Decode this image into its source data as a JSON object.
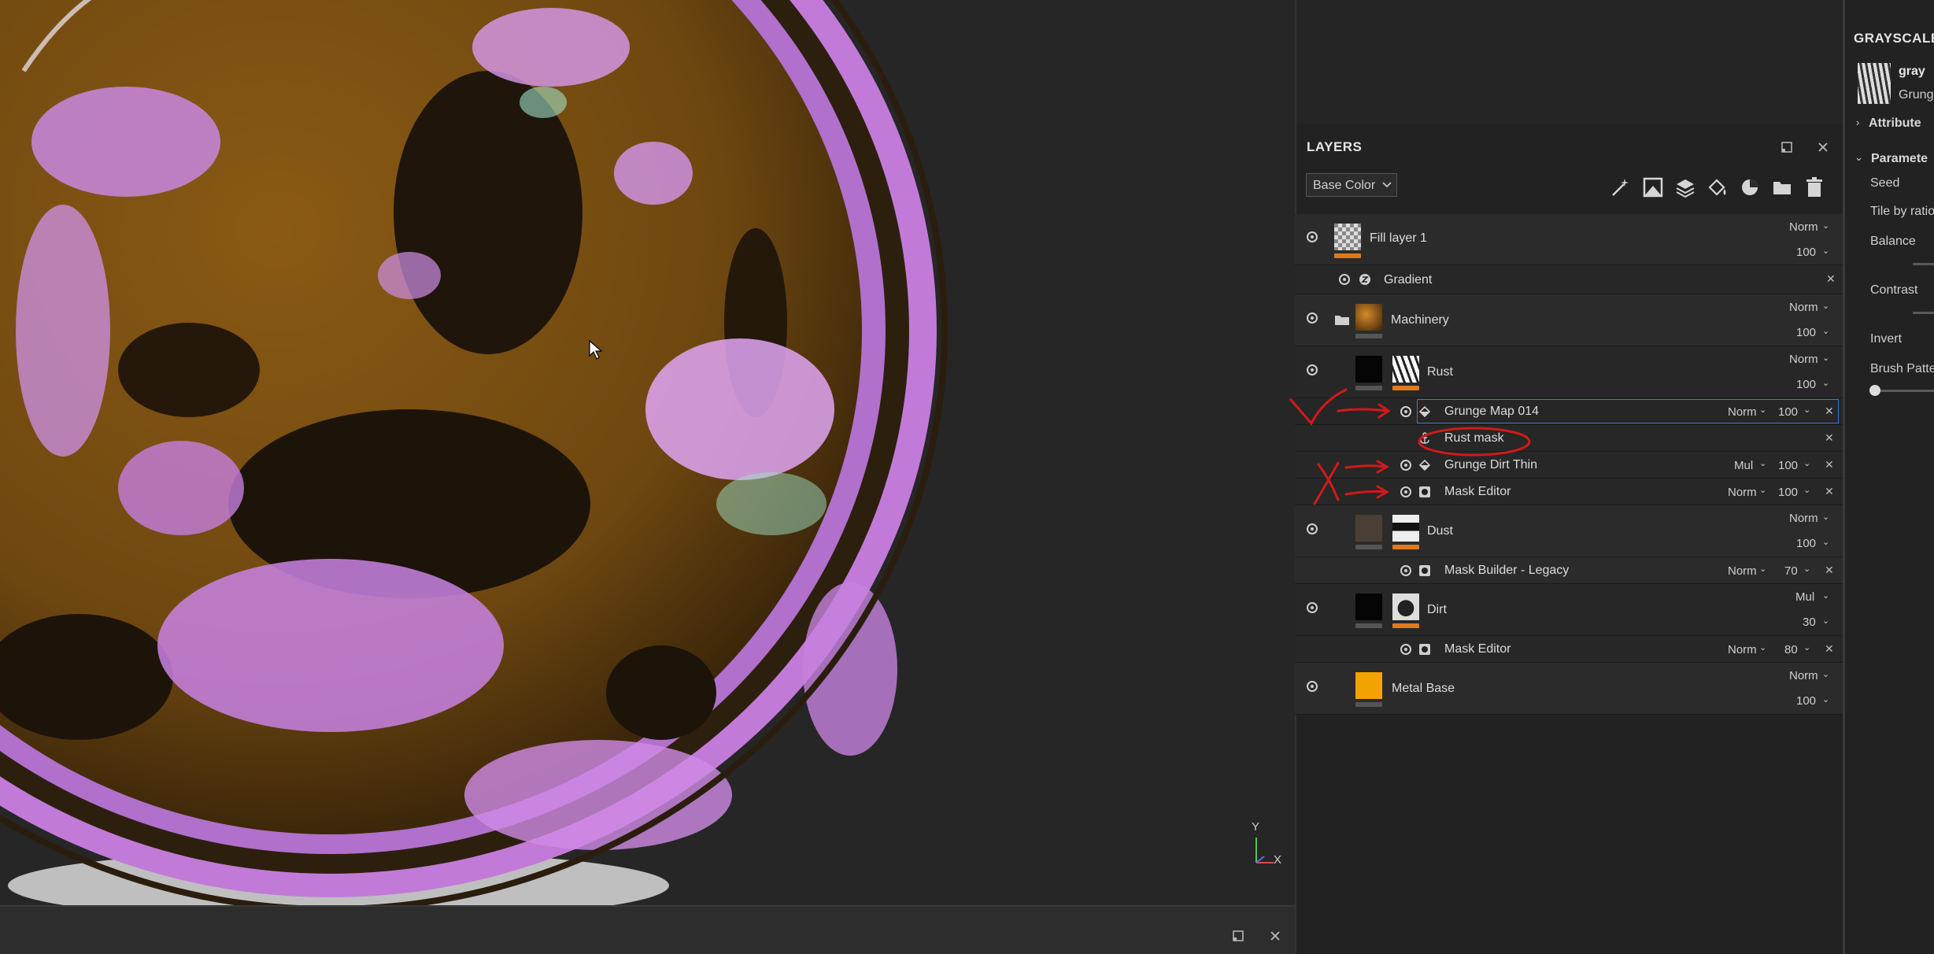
{
  "layers_panel": {
    "title": "LAYERS",
    "channel_select": "Base Color",
    "rows": [
      {
        "name": "Fill layer 1",
        "blend": "Norm",
        "opacity": "100"
      },
      {
        "name": "Gradient"
      },
      {
        "name": "Machinery",
        "blend": "Norm",
        "opacity": "100"
      },
      {
        "name": "Rust",
        "blend": "Norm",
        "opacity": "100"
      },
      {
        "name": "Grunge Map 014",
        "blend": "Norm",
        "opacity": "100"
      },
      {
        "name": "Rust mask"
      },
      {
        "name": "Grunge Dirt Thin",
        "blend": "Mul",
        "opacity": "100"
      },
      {
        "name": "Mask Editor",
        "blend": "Norm",
        "opacity": "100"
      },
      {
        "name": "Dust",
        "blend": "Norm",
        "opacity": "100"
      },
      {
        "name": "Mask Builder - Legacy",
        "blend": "Norm",
        "opacity": "70"
      },
      {
        "name": "Dirt",
        "blend": "Mul",
        "opacity": "30"
      },
      {
        "name": "Mask Editor",
        "blend": "Norm",
        "opacity": "80"
      },
      {
        "name": "Metal Base",
        "blend": "Norm",
        "opacity": "100"
      }
    ]
  },
  "properties_panel": {
    "title": "GRAYSCALE",
    "resource_name": "gray",
    "resource_sub": "Grung",
    "sections": {
      "attributes": "Attribute",
      "parameters": "Paramete"
    },
    "params": [
      "Seed",
      "Tile by ratio",
      "Balance",
      "Contrast",
      "Invert",
      "Brush Patte"
    ]
  },
  "viewport": {
    "axis_y": "Y",
    "axis_x": "X"
  },
  "colors": {
    "accent_orange": "#e07a1a",
    "selection_blue": "#2f7bd6",
    "annotation_red": "#d11a1a"
  }
}
